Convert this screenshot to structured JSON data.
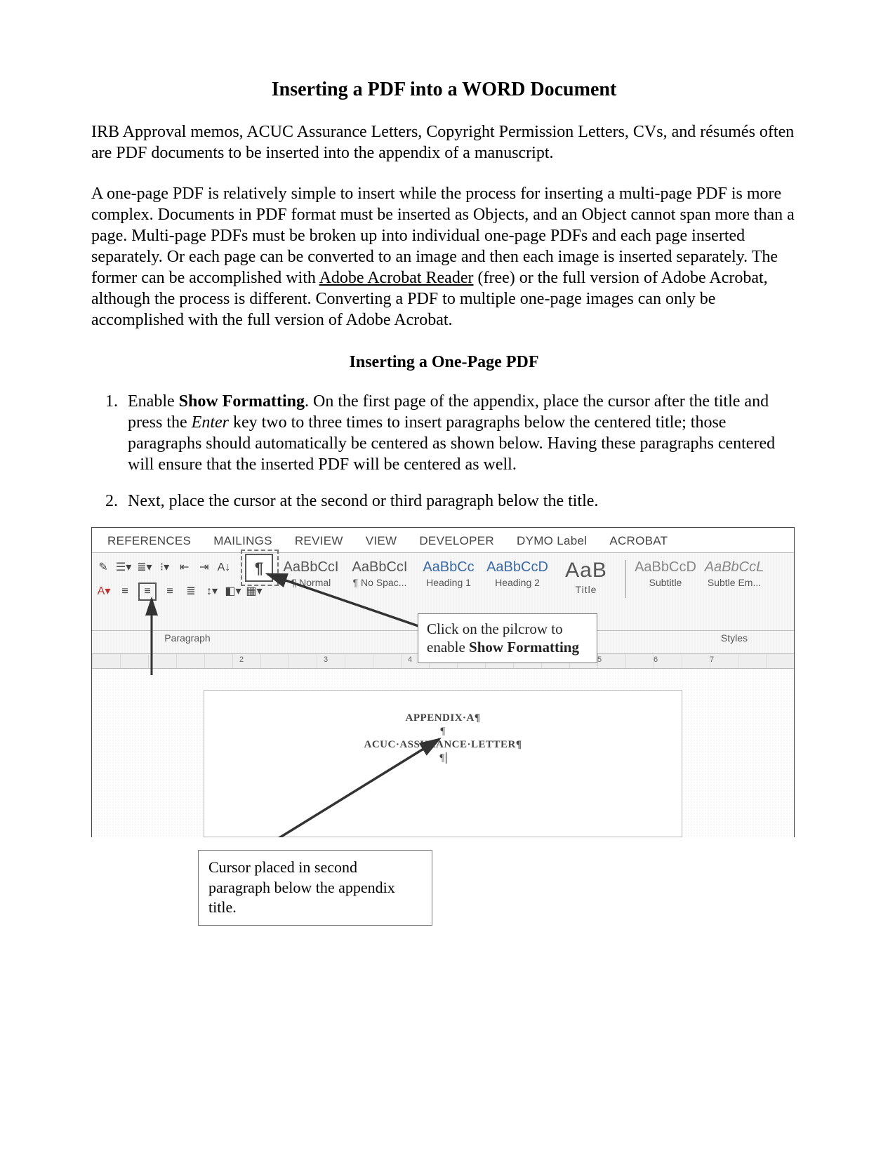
{
  "title": "Inserting a PDF into a WORD Document",
  "intro1": "IRB Approval memos, ACUC Assurance Letters, Copyright Permission Letters, CVs, and résumés often are PDF documents to be inserted into the appendix of a manuscript.",
  "intro2_a": "A one-page PDF is relatively simple to insert while the process for inserting a multi-page PDF is more complex. Documents in PDF format must be inserted as Objects, and an Object cannot span more than a page. Multi-page PDFs must be broken up into individual one-page PDFs and each page inserted separately. Or each page can be converted to an image and then each image is inserted separately. The former can be accomplished with ",
  "intro2_link": "Adobe Acrobat Reader",
  "intro2_b": " (free) or the full version of Adobe Acrobat, although the process is different. Converting a PDF to multiple one-page images can only be accomplished with the full version of Adobe Acrobat.",
  "subhead": "Inserting a One-Page PDF",
  "step1_a": "Enable ",
  "step1_b": "Show Formatting",
  "step1_c": ". On the first page of the appendix, place the cursor after the title and press the ",
  "step1_d": "Enter",
  "step1_e": " key two to three times to insert paragraphs below the centered title; those paragraphs should automatically be centered as shown below. Having these paragraphs centered will ensure that the inserted PDF will be centered as well.",
  "step2": "Next, place the cursor at the second or third paragraph below the title.",
  "ribbon": {
    "tabs": [
      "REFERENCES",
      "MAILINGS",
      "REVIEW",
      "VIEW",
      "DEVELOPER",
      "DYMO Label",
      "ACROBAT"
    ],
    "styles": [
      {
        "sample": "AaBbCcI",
        "name": "¶ Normal"
      },
      {
        "sample": "AaBbCcI",
        "name": "¶ No Spac..."
      },
      {
        "sample": "AaBbCc",
        "name": "Heading 1"
      },
      {
        "sample": "AaBbCcD",
        "name": "Heading 2"
      },
      {
        "sample": "AaB",
        "name": "Title",
        "big": true
      },
      {
        "sample": "AaBbCcD",
        "name": "Subtitle"
      },
      {
        "sample": "AaBbCcL",
        "name": "Subtle Em...",
        "italic": true
      }
    ],
    "group_paragraph": "Paragraph",
    "group_styles": "Styles",
    "pilcrow": "¶",
    "ruler_nums": [
      "2",
      "3",
      "4",
      "5",
      "6",
      "7"
    ]
  },
  "docpage": {
    "line1": "APPENDIX·A¶",
    "line2": "¶",
    "line3": "ACUC·ASSURANCE·LETTER¶",
    "line4": "¶"
  },
  "callout1_a": "Click on the pilcrow to enable ",
  "callout1_b": "Show Formatting",
  "callout2": "Cursor placed in second paragraph below the appendix title."
}
